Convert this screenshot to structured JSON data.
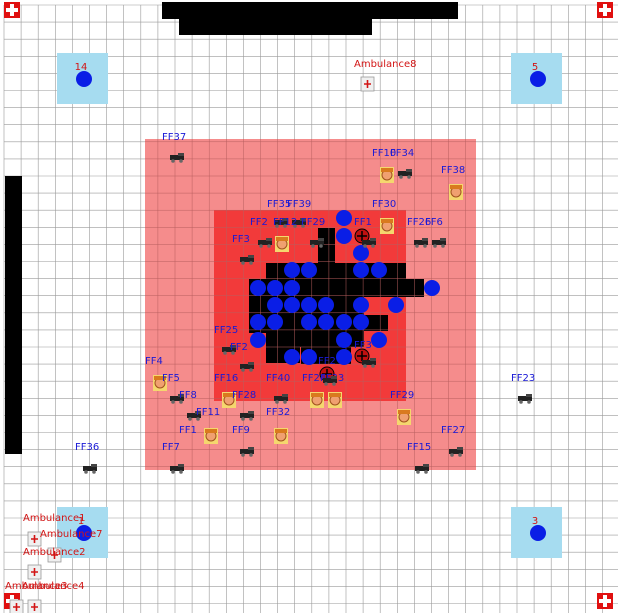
{
  "board": {
    "cols": 36,
    "rows": 36,
    "grid_color": "#9a9a9a"
  },
  "colors": {
    "zone_outer": "#f58c8c",
    "zone_inner": "#f23a3a",
    "burned": "#000000",
    "wall": "#000000",
    "water": "#0a1ee6",
    "base_fill": "#a6dcf0",
    "hospital": "#e01010",
    "ff_label": "#1a1ad6",
    "amb_label": "#d21414"
  },
  "bases": [
    {
      "id": "14",
      "label": "14"
    },
    {
      "id": "5",
      "label": "5"
    },
    {
      "id": "1",
      "label": "1"
    },
    {
      "id": "3",
      "label": "3"
    }
  ],
  "agents": [
    {
      "label": "FF37",
      "kind": "truck"
    },
    {
      "label": "FF10",
      "kind": "fighter"
    },
    {
      "label": "FF34",
      "kind": "truck"
    },
    {
      "label": "FF38",
      "kind": "fighter"
    },
    {
      "label": "FF35",
      "kind": "truck"
    },
    {
      "label": "FF39",
      "kind": "truck"
    },
    {
      "label": "FF2",
      "kind": "truck"
    },
    {
      "label": "FF12",
      "kind": "fighter"
    },
    {
      "label": "FF29",
      "kind": "truck"
    },
    {
      "label": "FF1",
      "kind": "truck"
    },
    {
      "label": "FF30",
      "kind": "fighter"
    },
    {
      "label": "FF26",
      "kind": "truck"
    },
    {
      "label": "FF6",
      "kind": "truck"
    },
    {
      "label": "FF3",
      "kind": "truck"
    },
    {
      "label": "FF25",
      "kind": "truck"
    },
    {
      "label": "FF2",
      "kind": "truck"
    },
    {
      "label": "FF4",
      "kind": "fighter"
    },
    {
      "label": "FF5",
      "kind": "truck"
    },
    {
      "label": "FF16",
      "kind": "fighter"
    },
    {
      "label": "FF40",
      "kind": "truck"
    },
    {
      "label": "FF24",
      "kind": "fighter"
    },
    {
      "label": "FF33",
      "kind": "fighter"
    },
    {
      "label": "FF3",
      "kind": "truck"
    },
    {
      "label": "FF2",
      "kind": "truck"
    },
    {
      "label": "FF8",
      "kind": "truck"
    },
    {
      "label": "FF28",
      "kind": "truck"
    },
    {
      "label": "FF11",
      "kind": "fighter"
    },
    {
      "label": "FF32",
      "kind": "fighter"
    },
    {
      "label": "FF29",
      "kind": "fighter"
    },
    {
      "label": "FF1",
      "kind": "fighter"
    },
    {
      "label": "FF9",
      "kind": "truck"
    },
    {
      "label": "FF27",
      "kind": "truck"
    },
    {
      "label": "FF36",
      "kind": "truck"
    },
    {
      "label": "FF7",
      "kind": "truck"
    },
    {
      "label": "FF15",
      "kind": "truck"
    },
    {
      "label": "FF23",
      "kind": "truck"
    },
    {
      "label": "Ambulance8",
      "kind": "ambulance"
    },
    {
      "label": "Ambulance1",
      "kind": "ambulance"
    },
    {
      "label": "Ambulance7",
      "kind": "ambulance"
    },
    {
      "label": "Ambulance2",
      "kind": "ambulance"
    },
    {
      "label": "Ambulance3",
      "kind": "ambulance"
    },
    {
      "label": "Ambulance4",
      "kind": "ambulance"
    }
  ]
}
